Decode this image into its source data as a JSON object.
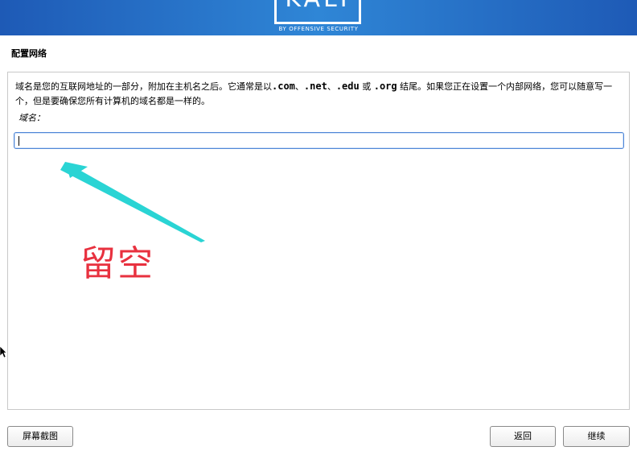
{
  "banner": {
    "logo": "KALI",
    "tagline": "BY OFFENSIVE SECURITY",
    "gradient_colors": [
      "#1e5ab6",
      "#2f86d6"
    ]
  },
  "page": {
    "title": "配置网络"
  },
  "main": {
    "description_parts": [
      "域名是您的互联网地址的一部分，附加在主机名之后。它通常是以",
      ".com",
      "、",
      ".net",
      "、",
      ".edu",
      " 或 ",
      ".org",
      " 结尾。如果您正在设置一个内部网络，您可以随意写一个，但是要确保您所有计算机的域名都是一样的。"
    ],
    "field_label": "域名：",
    "domain_value": ""
  },
  "annotation": {
    "text": "留空",
    "text_color": "#e8313f",
    "arrow_color": "#2ad4d4"
  },
  "buttons": {
    "screenshot": "屏幕截图",
    "back": "返回",
    "continue": "继续"
  }
}
